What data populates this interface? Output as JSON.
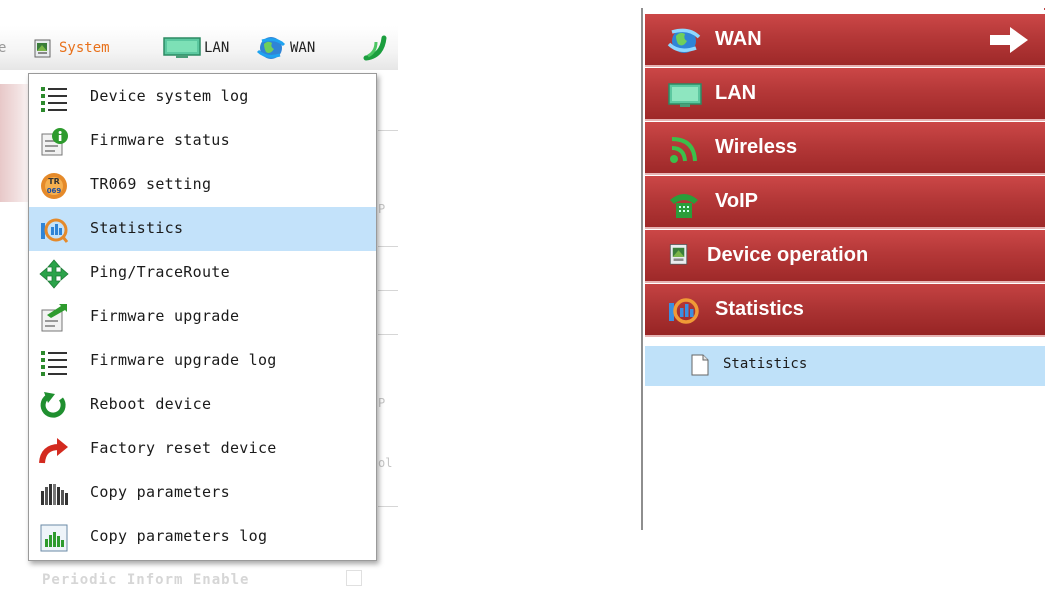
{
  "toolbar": {
    "partial_item": "e",
    "items": [
      {
        "label": "System",
        "icon": "device-operation-icon",
        "active": true
      },
      {
        "label": "LAN",
        "icon": "monitor-icon",
        "active": false
      },
      {
        "label": "WAN",
        "icon": "globe-icon",
        "active": false
      }
    ]
  },
  "system_menu": {
    "items": [
      {
        "label": "Device system log",
        "icon": "list-icon",
        "selected": false
      },
      {
        "label": "Firmware status",
        "icon": "info-document-icon",
        "selected": false
      },
      {
        "label": "TR069 setting",
        "icon": "tr069-gear-icon",
        "selected": false
      },
      {
        "label": "Statistics",
        "icon": "statistics-icon",
        "selected": true
      },
      {
        "label": "Ping/TraceRoute",
        "icon": "four-way-arrows-icon",
        "selected": false
      },
      {
        "label": "Firmware upgrade",
        "icon": "upgrade-document-icon",
        "selected": false
      },
      {
        "label": "Firmware upgrade log",
        "icon": "list-icon",
        "selected": false
      },
      {
        "label": "Reboot device",
        "icon": "reboot-arrow-icon",
        "selected": false
      },
      {
        "label": "Factory reset device",
        "icon": "reset-arrow-icon",
        "selected": false
      },
      {
        "label": "Copy parameters",
        "icon": "copy-bars-icon",
        "selected": false
      },
      {
        "label": "Copy parameters log",
        "icon": "copy-log-icon",
        "selected": false
      }
    ]
  },
  "background": {
    "bottom_text": "Periodic Inform Enable"
  },
  "sidebar": {
    "items": [
      {
        "label": "WAN",
        "icon": "globe-icon",
        "has_arrow": true
      },
      {
        "label": "LAN",
        "icon": "monitor-icon",
        "has_arrow": false
      },
      {
        "label": "Wireless",
        "icon": "wireless-icon",
        "has_arrow": false
      },
      {
        "label": "VoIP",
        "icon": "phone-icon",
        "has_arrow": false
      },
      {
        "label": "Device operation",
        "icon": "device-operation-icon",
        "has_arrow": false
      },
      {
        "label": "Statistics",
        "icon": "statistics-icon",
        "has_arrow": false
      }
    ],
    "sub_item": {
      "label": "Statistics",
      "icon": "document-icon",
      "selected": true
    }
  },
  "colors": {
    "menu_active": "#e8711b",
    "selection": "#c3e2fa",
    "sidebar_red": "#b53838"
  }
}
